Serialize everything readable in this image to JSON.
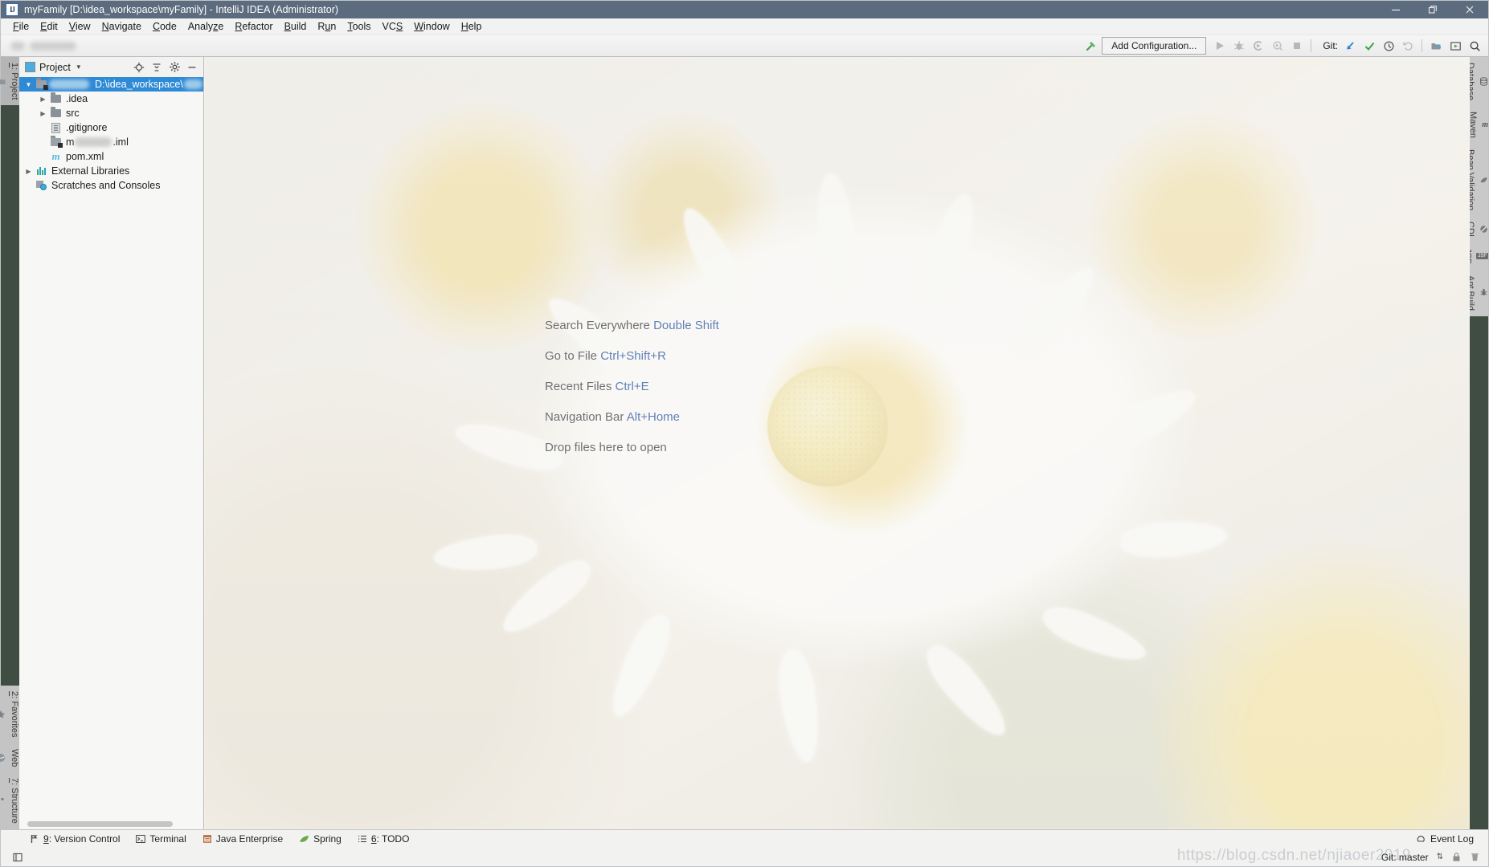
{
  "window": {
    "title": "myFamily [D:\\idea_workspace\\myFamily] - IntelliJ IDEA (Administrator)",
    "app_icon": "IJ",
    "minimize": "—",
    "maximize": "❐",
    "close": "✕"
  },
  "menubar": {
    "items": [
      {
        "label": "File",
        "mnemonic": "F"
      },
      {
        "label": "Edit",
        "mnemonic": "E"
      },
      {
        "label": "View",
        "mnemonic": "V"
      },
      {
        "label": "Navigate",
        "mnemonic": "N"
      },
      {
        "label": "Code",
        "mnemonic": "C"
      },
      {
        "label": "Analyze",
        "mnemonic": "z"
      },
      {
        "label": "Refactor",
        "mnemonic": "R"
      },
      {
        "label": "Build",
        "mnemonic": "B"
      },
      {
        "label": "Run",
        "mnemonic": "u"
      },
      {
        "label": "Tools",
        "mnemonic": "T"
      },
      {
        "label": "VCS",
        "mnemonic": "S"
      },
      {
        "label": "Window",
        "mnemonic": "W"
      },
      {
        "label": "Help",
        "mnemonic": "H"
      }
    ]
  },
  "toolbar": {
    "add_configuration": "Add Configuration...",
    "git_label": "Git:",
    "icons": [
      "hammer-build-icon",
      "run-icon",
      "debug-icon",
      "run-with-coverage-icon",
      "profile-icon",
      "stop-icon",
      "update-project-icon",
      "commit-icon",
      "history-icon",
      "rollback-icon",
      "project-structure-icon",
      "select-in-icon",
      "search-everywhere-icon"
    ]
  },
  "left_stripe": {
    "top": [
      {
        "label": "1: Project",
        "mnemonic": "1",
        "icon": "project-folder-icon",
        "selected": true
      }
    ],
    "bottom": [
      {
        "label": "2: Favorites",
        "mnemonic": "2",
        "icon": "star-icon"
      },
      {
        "label": "Web",
        "icon": "web-globe-icon"
      },
      {
        "label": "7: Structure",
        "mnemonic": "7",
        "icon": "structure-icon"
      }
    ]
  },
  "right_stripe": {
    "items": [
      {
        "label": "Database",
        "icon": "database-icon"
      },
      {
        "label": "Maven",
        "icon": "maven-m-icon"
      },
      {
        "label": "Bean Validation",
        "icon": "bean-validation-icon"
      },
      {
        "label": "CDI",
        "icon": "cdi-icon"
      },
      {
        "label": "JSF",
        "icon": "jsf-icon"
      },
      {
        "label": "Ant Build",
        "icon": "ant-build-icon"
      }
    ]
  },
  "project_panel": {
    "title": "Project",
    "actions": [
      "locate-in-tree-icon",
      "collapse-all-icon",
      "settings-gear-icon",
      "hide-minimize-icon"
    ],
    "tree": [
      {
        "id": "root",
        "label_redacted": true,
        "path": "D:\\idea_workspace\\",
        "indent": 0,
        "arrow": "expanded",
        "icon": "module-folder-icon",
        "selected": true
      },
      {
        "id": "idea",
        "label": ".idea",
        "indent": 1,
        "arrow": "collapsed",
        "icon": "folder-icon",
        "selected": false
      },
      {
        "id": "src",
        "label": "src",
        "indent": 1,
        "arrow": "collapsed",
        "icon": "folder-icon",
        "selected": false
      },
      {
        "id": "gitignore",
        "label": ".gitignore",
        "indent": 1,
        "arrow": "none",
        "icon": "text-file-icon",
        "selected": false
      },
      {
        "id": "iml",
        "label_redacted": true,
        "label_prefix": "m",
        "label_suffix": ".iml",
        "indent": 1,
        "arrow": "none",
        "icon": "iml-file-icon",
        "selected": false
      },
      {
        "id": "pom",
        "label": "pom.xml",
        "indent": 1,
        "arrow": "none",
        "icon": "maven-m-icon",
        "selected": false
      },
      {
        "id": "extlibs",
        "label": "External Libraries",
        "indent": 0,
        "arrow": "collapsed",
        "icon": "library-icon",
        "selected": false
      },
      {
        "id": "scratches",
        "label": "Scratches and Consoles",
        "indent": 0,
        "arrow": "none",
        "icon": "scratches-icon",
        "selected": false
      }
    ]
  },
  "editor_hints": {
    "rows": [
      {
        "action": "Search Everywhere",
        "shortcut": "Double Shift"
      },
      {
        "action": "Go to File",
        "shortcut": "Ctrl+Shift+R"
      },
      {
        "action": "Recent Files",
        "shortcut": "Ctrl+E"
      },
      {
        "action": "Navigation Bar",
        "shortcut": "Alt+Home"
      },
      {
        "action": "Drop files here to open",
        "shortcut": ""
      }
    ]
  },
  "bottom_bar": {
    "items": [
      {
        "label": "9: Version Control",
        "mnemonic": "9",
        "icon": "version-control-branch-icon"
      },
      {
        "label": "Terminal",
        "icon": "terminal-icon"
      },
      {
        "label": "Java Enterprise",
        "icon": "java-enterprise-icon"
      },
      {
        "label": "Spring",
        "icon": "spring-leaf-icon"
      },
      {
        "label": "6: TODO",
        "mnemonic": "6",
        "icon": "todo-list-icon"
      }
    ],
    "event_log": "Event Log",
    "event_log_icon": "event-log-icon"
  },
  "status_bar": {
    "left_icon": "toggle-toolwindow-icon",
    "git_branch": "Git: master",
    "branch_caret": "⇅",
    "icons": [
      "lock-icon",
      "trash-icon"
    ]
  },
  "watermark": "https://blog.csdn.net/njiaoer2019",
  "colors": {
    "titlebar": "#5c6b7d",
    "accent_selection": "#2f8ad6",
    "hint_text": "#6f6f72",
    "hint_key": "#5f7fb5",
    "stripe": "#404d43"
  }
}
